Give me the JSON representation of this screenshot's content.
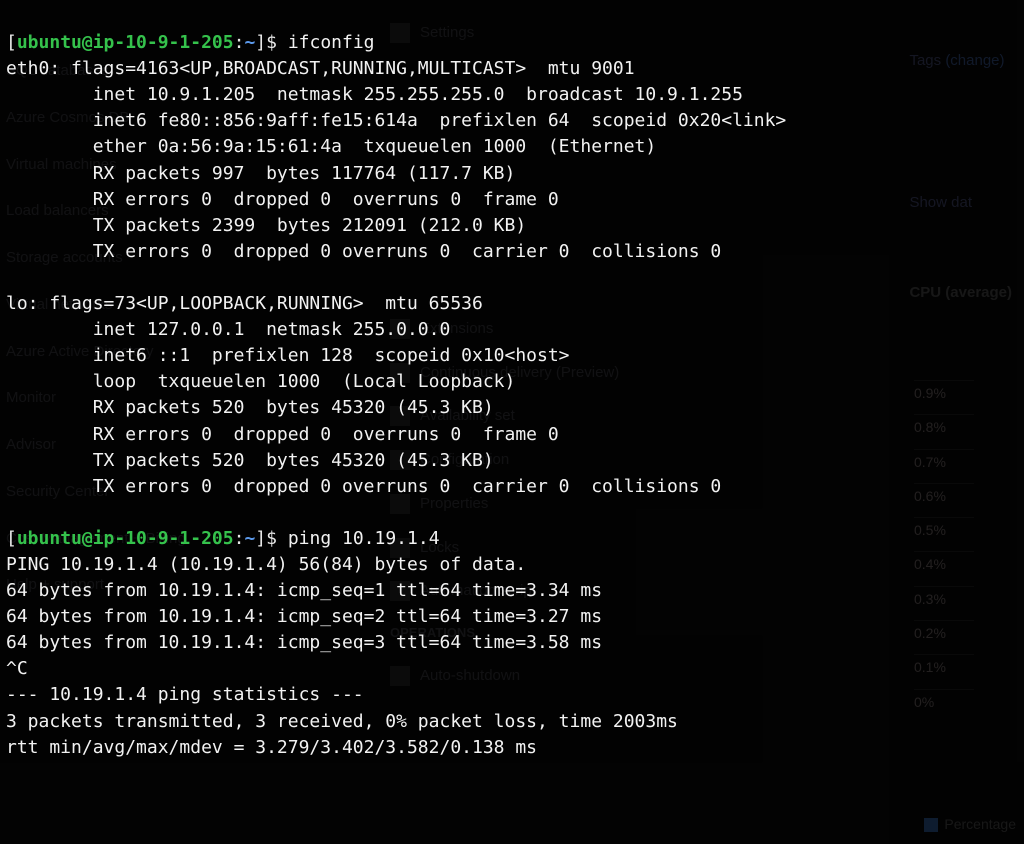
{
  "background": {
    "sidebar": {
      "items": [
        "SQL databases",
        "Azure Cosmos DB",
        "Virtual machines",
        "Load balancers",
        "Storage accounts",
        "Virtual networks",
        "Azure Active Directory",
        "Monitor",
        "Advisor",
        "Security Center",
        "Cost Management + Billing",
        "Help + support"
      ]
    },
    "main": {
      "items": [
        "Settings",
        "Extensions",
        "Continuous delivery (Preview)",
        "Availability set",
        "Configuration",
        "Properties",
        "Locks",
        "Automation script",
        "Operations",
        "Auto-shutdown"
      ]
    },
    "right": {
      "tags_label": "Tags",
      "tags_change": "(change)",
      "show_data": "Show dat",
      "cpu_title": "CPU (average)",
      "y_ticks": [
        "0.9%",
        "0.8%",
        "0.7%",
        "0.6%",
        "0.5%",
        "0.4%",
        "0.3%",
        "0.2%",
        "0.1%",
        "0%"
      ],
      "percentage_label": "Percentage"
    }
  },
  "terminal": {
    "prompt": {
      "user_host": "ubuntu@ip-10-9-1-205",
      "path": "~",
      "sep": ":",
      "sigil": "$"
    },
    "commands": {
      "ifconfig": "ifconfig",
      "ping": "ping 10.19.1.4"
    },
    "ifconfig_output": {
      "eth0": [
        "eth0: flags=4163<UP,BROADCAST,RUNNING,MULTICAST>  mtu 9001",
        "        inet 10.9.1.205  netmask 255.255.255.0  broadcast 10.9.1.255",
        "        inet6 fe80::856:9aff:fe15:614a  prefixlen 64  scopeid 0x20<link>",
        "        ether 0a:56:9a:15:61:4a  txqueuelen 1000  (Ethernet)",
        "        RX packets 997  bytes 117764 (117.7 KB)",
        "        RX errors 0  dropped 0  overruns 0  frame 0",
        "        TX packets 2399  bytes 212091 (212.0 KB)",
        "        TX errors 0  dropped 0 overruns 0  carrier 0  collisions 0"
      ],
      "lo": [
        "lo: flags=73<UP,LOOPBACK,RUNNING>  mtu 65536",
        "        inet 127.0.0.1  netmask 255.0.0.0",
        "        inet6 ::1  prefixlen 128  scopeid 0x10<host>",
        "        loop  txqueuelen 1000  (Local Loopback)",
        "        RX packets 520  bytes 45320 (45.3 KB)",
        "        RX errors 0  dropped 0  overruns 0  frame 0",
        "        TX packets 520  bytes 45320 (45.3 KB)",
        "        TX errors 0  dropped 0 overruns 0  carrier 0  collisions 0"
      ]
    },
    "ping_output": [
      "PING 10.19.1.4 (10.19.1.4) 56(84) bytes of data.",
      "64 bytes from 10.19.1.4: icmp_seq=1 ttl=64 time=3.34 ms",
      "64 bytes from 10.19.1.4: icmp_seq=2 ttl=64 time=3.27 ms",
      "64 bytes from 10.19.1.4: icmp_seq=3 ttl=64 time=3.58 ms",
      "^C",
      "--- 10.19.1.4 ping statistics ---",
      "3 packets transmitted, 3 received, 0% packet loss, time 2003ms",
      "rtt min/avg/max/mdev = 3.279/3.402/3.582/0.138 ms"
    ]
  }
}
